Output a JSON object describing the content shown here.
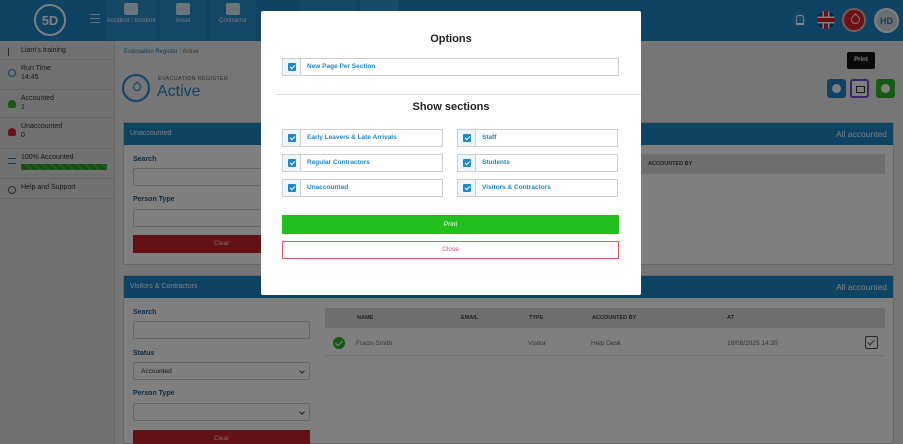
{
  "topbar": {
    "logo_text": "5D",
    "nav": [
      {
        "label": "Accident / Incident",
        "icon": "accident-icon"
      },
      {
        "label": "Asset",
        "icon": "asset-icon"
      },
      {
        "label": "Contractor",
        "icon": "contractor-icon"
      }
    ],
    "avatar_initials": "HD",
    "accent_color": "#1f86c7"
  },
  "sidebar": {
    "training": "Liam's training",
    "run_time_label": "Run Time",
    "run_time_value": "14:45",
    "accounted_label": "Accounted",
    "accounted_value": "1",
    "unaccounted_label": "Unaccounted",
    "unaccounted_value": "0",
    "percent_label": "100% Accounted",
    "percent_value": 100,
    "help": "Help and Support"
  },
  "breadcrumb": {
    "root": "Evacuation Register",
    "separator": "/",
    "current": "Active"
  },
  "header": {
    "small_title": "EVACUATION REGISTER",
    "big_title": "Active",
    "tooltip": "Print"
  },
  "panel_unaccounted": {
    "title": "Unaccounted",
    "status": "All accounted",
    "search_label": "Search",
    "person_type_label": "Person Type",
    "clear_label": "Clear",
    "columns": {
      "accounted_by": "ACCOUNTED BY"
    }
  },
  "panel_visitors": {
    "title": "Visitors & Contractors",
    "status": "All accounted",
    "search_label": "Search",
    "status_label": "Status",
    "status_value": "Accounted",
    "person_type_label": "Person Type",
    "clear_label": "Clear",
    "columns": {
      "name": "NAME",
      "email": "EMAIL",
      "type": "TYPE",
      "accounted_by": "ACCOUNTED BY",
      "at": "AT"
    },
    "rows": [
      {
        "name": "Fracis Smith",
        "email": "",
        "type": "Visitor",
        "accounted_by": "Help Desk",
        "at": "18/08/2025 14:20"
      }
    ]
  },
  "modal": {
    "options_title": "Options",
    "new_page": "New Page Per Section",
    "sections_title": "Show sections",
    "sections": {
      "early_leavers": "Early Leavers & Late Arrivals",
      "staff": "Staff",
      "regular_contractors": "Regular Contractors",
      "students": "Students",
      "unaccounted": "Unaccounted",
      "visitors": "Visitors & Contractors"
    },
    "print_label": "Print",
    "close_label": "Close",
    "print_color": "#22c01c",
    "close_color": "#e0454d"
  }
}
